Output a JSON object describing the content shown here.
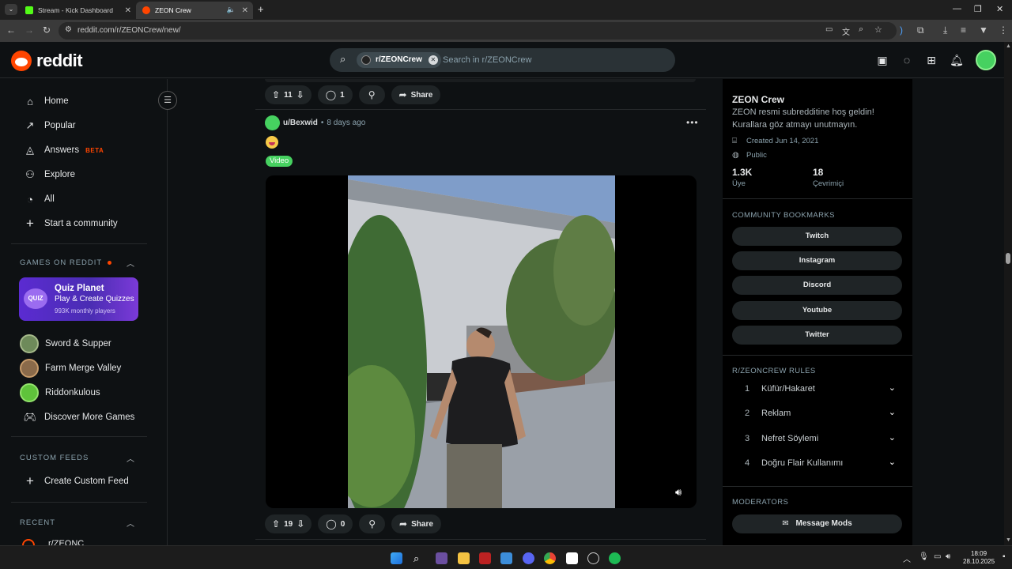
{
  "browser": {
    "tabs": [
      {
        "label": "Stream - Kick Dashboard",
        "active": false
      },
      {
        "label": "ZEON Crew",
        "active": true
      }
    ],
    "url": "reddit.com/r/ZEONCrew/new/"
  },
  "header": {
    "logo_text": "reddit",
    "search_chip": "r/ZEONCrew",
    "search_placeholder": "Search in r/ZEONCrew"
  },
  "sidebar": {
    "nav": [
      {
        "label": "Home",
        "icon": "home-icon"
      },
      {
        "label": "Popular",
        "icon": "popular-icon"
      },
      {
        "label": "Answers",
        "icon": "answers-icon",
        "badge": "BETA"
      },
      {
        "label": "Explore",
        "icon": "explore-icon"
      },
      {
        "label": "All",
        "icon": "all-icon"
      },
      {
        "label": "Start a community",
        "icon": "plus-icon"
      }
    ],
    "games_heading": "GAMES ON REDDIT",
    "featured_game": {
      "title": "Quiz Planet",
      "subtitle": "Play & Create Quizzes",
      "players": "993K monthly players",
      "logo_text": "QUIZ"
    },
    "games": [
      {
        "label": "Sword & Supper"
      },
      {
        "label": "Farm Merge Valley"
      },
      {
        "label": "Riddonkulous"
      },
      {
        "label": "Discover More Games"
      }
    ],
    "custom_feeds_heading": "CUSTOM FEEDS",
    "create_custom_feed": "Create Custom Feed",
    "recent_heading": "RECENT",
    "recent_item": "r/ZEONC"
  },
  "feed": {
    "prev_post": {
      "votes": "11",
      "comments": "1",
      "share": "Share"
    },
    "post": {
      "author": "u/Bexwid",
      "age": "8 days ago",
      "flair": "Video",
      "votes": "19",
      "comments": "0",
      "share": "Share"
    }
  },
  "community": {
    "name": "ZEON Crew",
    "description": "ZEON resmi subredditine hoş geldin! Kurallara göz atmayı unutmayın.",
    "created": "Created Jun 14, 2021",
    "visibility": "Public",
    "members_value": "1.3K",
    "members_label": "Üye",
    "online_value": "18",
    "online_label": "Çevrimiçi",
    "bookmarks_heading": "COMMUNITY BOOKMARKS",
    "bookmarks": [
      "Twitch",
      "Instagram",
      "Discord",
      "Youtube",
      "Twitter"
    ],
    "rules_heading": "R/ZEONCREW RULES",
    "rules": [
      {
        "num": "1",
        "text": "Küfür/Hakaret"
      },
      {
        "num": "2",
        "text": "Reklam"
      },
      {
        "num": "3",
        "text": "Nefret Söylemi"
      },
      {
        "num": "4",
        "text": "Doğru Flair Kullanımı"
      }
    ],
    "moderators_heading": "MODERATORS",
    "message_mods": "Message Mods"
  },
  "taskbar": {
    "time": "18:09",
    "date": "28.10.2025"
  },
  "colors": {
    "reddit_orange": "#ff4500",
    "flair_green": "#46d160",
    "background": "#0e1113"
  }
}
